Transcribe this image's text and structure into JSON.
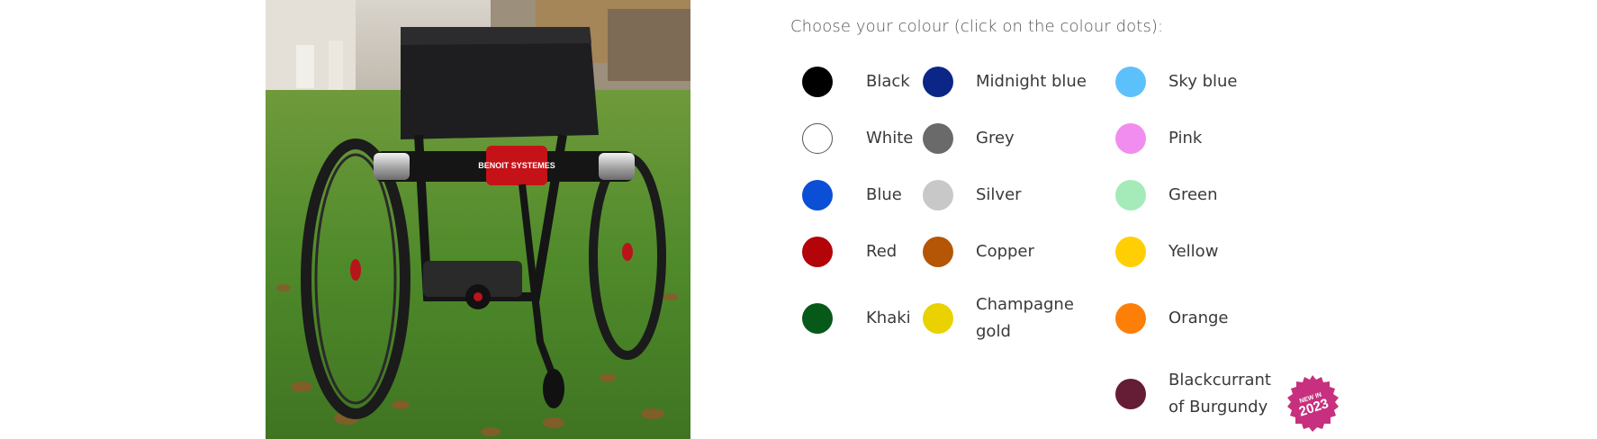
{
  "intro_text": "Choose your colour (click on the colour dots):",
  "photo": {
    "brand_text": "BENOIT SYSTEMES"
  },
  "colours": [
    {
      "label": "Black",
      "color": "#000000"
    },
    {
      "label": "White",
      "color": "#ffffff"
    },
    {
      "label": "Blue",
      "color": "#0a4fd6"
    },
    {
      "label": "Red",
      "color": "#b20409"
    },
    {
      "label": "Khaki",
      "color": "#07591a"
    },
    {
      "label": "Midnight blue",
      "color": "#0b2687"
    },
    {
      "label": "Grey",
      "color": "#6a6a6a"
    },
    {
      "label": "Silver",
      "color": "#c8c8c8"
    },
    {
      "label": "Copper",
      "color": "#b45606"
    },
    {
      "label": "Champagne gold",
      "color": "#ead200"
    },
    {
      "label": "Sky blue",
      "color": "#5cc1fb"
    },
    {
      "label": "Pink",
      "color": "#f28df0"
    },
    {
      "label": "Green",
      "color": "#a5eab9"
    },
    {
      "label": "Yellow",
      "color": "#ffcf03"
    },
    {
      "label": "Orange",
      "color": "#fd7f08"
    },
    {
      "label": "Blackcurrant of Burgundy",
      "color": "#641d35"
    }
  ],
  "badge": {
    "line1": "NEW IN",
    "line2": "2023",
    "color": "#c7307e"
  }
}
